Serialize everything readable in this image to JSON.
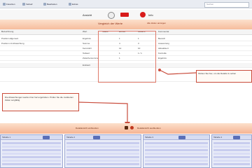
{
  "topbar": {
    "btn1": "Favoriten",
    "btn2": "Verlauf",
    "btn3": "Bearbeiten",
    "btn4": "Extras",
    "search_placeholder": "Suchen"
  },
  "toolbar": {
    "label_left": "Ansicht",
    "label_right": "Info"
  },
  "band": {
    "title": "Vergleich der Werte",
    "link": "Alle Zeilen anzeigen"
  },
  "columns": [
    "Bezeichnung",
    "Wert",
    "Status",
    "Einheit",
    "Gesamt",
    "Kommentar"
  ],
  "rows": [
    {
      "a": "Position allgemein",
      "b": "Ergebnis",
      "c": "1",
      "d": "1",
      "e": "Bereich"
    },
    {
      "a": "Position mit Abweichung",
      "b": "Summe",
      "c": "4",
      "d": "3",
      "e": "Auswertung"
    },
    {
      "a": "",
      "b": "Kennzahl",
      "c": "12",
      "d": "10",
      "e": "Aktualisiert"
    },
    {
      "a": "",
      "b": "Teilwert",
      "c": "1",
      "d": "1 / 1",
      "e": "Kontrolle"
    },
    {
      "a": "",
      "b": "Zwischensumme",
      "c": "1",
      "d": "",
      "e": "Ergebnis"
    },
    {
      "a": "",
      "b": "Endwert",
      "c": "",
      "d": "",
      "e": ""
    },
    {
      "a": "",
      "b": "",
      "c": "",
      "d": "",
      "e": ""
    }
  ],
  "callout1": "Klicken Sie hier, um die Details zu sehen",
  "callout2": "Die Abweichungen werden hier hervorgehoben. Prüfen Sie die markierten Zeilen sorgfältig.",
  "band2": {
    "left": "Detailansicht einblenden",
    "right": "Detailansicht ausblenden"
  },
  "panels": [
    "Tabelle 1",
    "Tabelle 2",
    "Tabelle 3",
    "Tabelle 4"
  ],
  "colors": {
    "accent_red": "#d81b1b",
    "band_peach": "#f5b896",
    "panel_blue": "#e9ecf8",
    "callout_border": "#c94c3c"
  }
}
